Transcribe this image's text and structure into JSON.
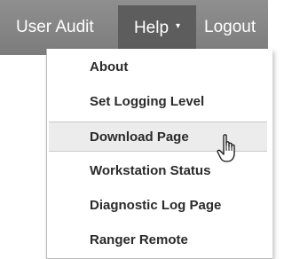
{
  "navbar": {
    "items": [
      {
        "label": "User Audit"
      },
      {
        "label": "Help",
        "caret": "▾"
      },
      {
        "label": "Logout"
      }
    ]
  },
  "help_menu": {
    "items": [
      {
        "label": "About"
      },
      {
        "label": "Set Logging Level"
      },
      {
        "label": "Download Page",
        "state": "hovered"
      },
      {
        "label": "Workstation Status"
      },
      {
        "label": "Diagnostic Log Page"
      },
      {
        "label": "Ranger Remote"
      }
    ]
  },
  "icons": {
    "caret": "caret-down-icon",
    "cursor": "hand-pointer-cursor-icon"
  },
  "colors": {
    "navbar_bg": "#888888",
    "help_active_bg": "#5d5d5d",
    "menu_hover_bg": "#ececec"
  }
}
